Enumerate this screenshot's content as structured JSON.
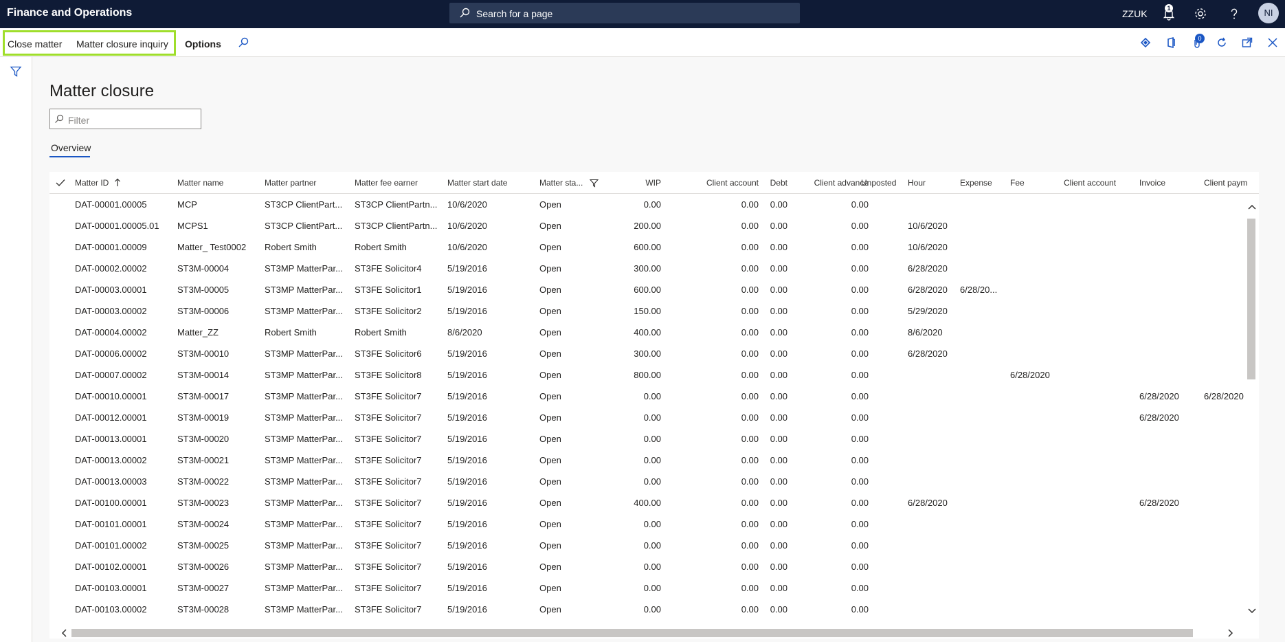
{
  "topbar": {
    "app_title": "Finance and Operations",
    "search_placeholder": "Search for a page",
    "company": "ZZUK",
    "notification_count": "1",
    "user_initials": "NI"
  },
  "actionbar": {
    "close_matter": "Close matter",
    "closure_inquiry": "Matter closure inquiry",
    "options": "Options",
    "attachments_count": "0"
  },
  "page": {
    "title": "Matter closure",
    "filter_placeholder": "Filter",
    "tab_overview": "Overview"
  },
  "grid": {
    "columns": [
      "Matter ID",
      "Matter name",
      "Matter partner",
      "Matter fee earner",
      "Matter start date",
      "Matter sta...",
      "WIP",
      "Client account",
      "Debt",
      "Client advance",
      "Unposted",
      "Hour",
      "Expense",
      "Fee",
      "Client account",
      "Invoice",
      "Client paym"
    ],
    "rows": [
      [
        "DAT-00001.00005",
        "MCP",
        "ST3CP ClientPart...",
        "ST3CP ClientPartn...",
        "10/6/2020",
        "Open",
        "0.00",
        "0.00",
        "0.00",
        "0.00",
        "",
        "",
        "",
        "",
        "",
        "",
        ""
      ],
      [
        "DAT-00001.00005.01",
        "MCPS1",
        "ST3CP ClientPart...",
        "ST3CP ClientPartn...",
        "10/6/2020",
        "Open",
        "200.00",
        "0.00",
        "0.00",
        "0.00",
        "",
        "10/6/2020",
        "",
        "",
        "",
        "",
        ""
      ],
      [
        "DAT-00001.00009",
        "Matter_ Test0002",
        "Robert Smith",
        "Robert Smith",
        "10/6/2020",
        "Open",
        "600.00",
        "0.00",
        "0.00",
        "0.00",
        "",
        "10/6/2020",
        "",
        "",
        "",
        "",
        ""
      ],
      [
        "DAT-00002.00002",
        "ST3M-00004",
        "ST3MP MatterPar...",
        "ST3FE Solicitor4",
        "5/19/2016",
        "Open",
        "300.00",
        "0.00",
        "0.00",
        "0.00",
        "",
        "6/28/2020",
        "",
        "",
        "",
        "",
        ""
      ],
      [
        "DAT-00003.00001",
        "ST3M-00005",
        "ST3MP MatterPar...",
        "ST3FE Solicitor1",
        "5/19/2016",
        "Open",
        "600.00",
        "0.00",
        "0.00",
        "0.00",
        "",
        "6/28/2020",
        "6/28/20...",
        "",
        "",
        "",
        ""
      ],
      [
        "DAT-00003.00002",
        "ST3M-00006",
        "ST3MP MatterPar...",
        "ST3FE Solicitor2",
        "5/19/2016",
        "Open",
        "150.00",
        "0.00",
        "0.00",
        "0.00",
        "",
        "5/29/2020",
        "",
        "",
        "",
        "",
        ""
      ],
      [
        "DAT-00004.00002",
        "Matter_ZZ",
        "Robert Smith",
        "Robert Smith",
        "8/6/2020",
        "Open",
        "400.00",
        "0.00",
        "0.00",
        "0.00",
        "",
        "8/6/2020",
        "",
        "",
        "",
        "",
        ""
      ],
      [
        "DAT-00006.00002",
        "ST3M-00010",
        "ST3MP MatterPar...",
        "ST3FE Solicitor6",
        "5/19/2016",
        "Open",
        "300.00",
        "0.00",
        "0.00",
        "0.00",
        "",
        "6/28/2020",
        "",
        "",
        "",
        "",
        ""
      ],
      [
        "DAT-00007.00002",
        "ST3M-00014",
        "ST3MP MatterPar...",
        "ST3FE Solicitor8",
        "5/19/2016",
        "Open",
        "800.00",
        "0.00",
        "0.00",
        "0.00",
        "",
        "",
        "",
        "6/28/2020",
        "",
        "",
        ""
      ],
      [
        "DAT-00010.00001",
        "ST3M-00017",
        "ST3MP MatterPar...",
        "ST3FE Solicitor7",
        "5/19/2016",
        "Open",
        "0.00",
        "0.00",
        "0.00",
        "0.00",
        "",
        "",
        "",
        "",
        "",
        "6/28/2020",
        "6/28/2020"
      ],
      [
        "DAT-00012.00001",
        "ST3M-00019",
        "ST3MP MatterPar...",
        "ST3FE Solicitor7",
        "5/19/2016",
        "Open",
        "0.00",
        "0.00",
        "0.00",
        "0.00",
        "",
        "",
        "",
        "",
        "",
        "6/28/2020",
        ""
      ],
      [
        "DAT-00013.00001",
        "ST3M-00020",
        "ST3MP MatterPar...",
        "ST3FE Solicitor7",
        "5/19/2016",
        "Open",
        "0.00",
        "0.00",
        "0.00",
        "0.00",
        "",
        "",
        "",
        "",
        "",
        "",
        ""
      ],
      [
        "DAT-00013.00002",
        "ST3M-00021",
        "ST3MP MatterPar...",
        "ST3FE Solicitor7",
        "5/19/2016",
        "Open",
        "0.00",
        "0.00",
        "0.00",
        "0.00",
        "",
        "",
        "",
        "",
        "",
        "",
        ""
      ],
      [
        "DAT-00013.00003",
        "ST3M-00022",
        "ST3MP MatterPar...",
        "ST3FE Solicitor7",
        "5/19/2016",
        "Open",
        "0.00",
        "0.00",
        "0.00",
        "0.00",
        "",
        "",
        "",
        "",
        "",
        "",
        ""
      ],
      [
        "DAT-00100.00001",
        "ST3M-00023",
        "ST3MP MatterPar...",
        "ST3FE Solicitor7",
        "5/19/2016",
        "Open",
        "400.00",
        "0.00",
        "0.00",
        "0.00",
        "",
        "6/28/2020",
        "",
        "",
        "",
        "6/28/2020",
        ""
      ],
      [
        "DAT-00101.00001",
        "ST3M-00024",
        "ST3MP MatterPar...",
        "ST3FE Solicitor7",
        "5/19/2016",
        "Open",
        "0.00",
        "0.00",
        "0.00",
        "0.00",
        "",
        "",
        "",
        "",
        "",
        "",
        ""
      ],
      [
        "DAT-00101.00002",
        "ST3M-00025",
        "ST3MP MatterPar...",
        "ST3FE Solicitor7",
        "5/19/2016",
        "Open",
        "0.00",
        "0.00",
        "0.00",
        "0.00",
        "",
        "",
        "",
        "",
        "",
        "",
        ""
      ],
      [
        "DAT-00102.00001",
        "ST3M-00026",
        "ST3MP MatterPar...",
        "ST3FE Solicitor7",
        "5/19/2016",
        "Open",
        "0.00",
        "0.00",
        "0.00",
        "0.00",
        "",
        "",
        "",
        "",
        "",
        "",
        ""
      ],
      [
        "DAT-00103.00001",
        "ST3M-00027",
        "ST3MP MatterPar...",
        "ST3FE Solicitor7",
        "5/19/2016",
        "Open",
        "0.00",
        "0.00",
        "0.00",
        "0.00",
        "",
        "",
        "",
        "",
        "",
        "",
        ""
      ],
      [
        "DAT-00103.00002",
        "ST3M-00028",
        "ST3MP MatterPar...",
        "ST3FE Solicitor7",
        "5/19/2016",
        "Open",
        "0.00",
        "0.00",
        "0.00",
        "0.00",
        "",
        "",
        "",
        "",
        "",
        "",
        ""
      ]
    ]
  },
  "colors": {
    "topbar": "#0f1b36",
    "accent": "#1a56c4",
    "highlight": "#9fde2b"
  }
}
